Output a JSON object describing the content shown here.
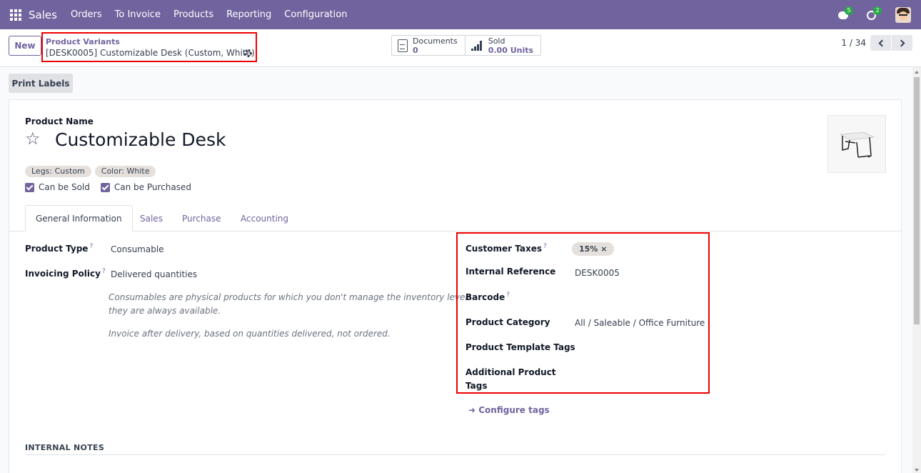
{
  "navbar": {
    "app_name": "Sales",
    "menu": [
      "Orders",
      "To Invoice",
      "Products",
      "Reporting",
      "Configuration"
    ],
    "messages_count": "5",
    "activities_count": "2"
  },
  "control": {
    "new_label": "New",
    "breadcrumb_parent": "Product Variants",
    "breadcrumb_current": "[DESK0005] Customizable Desk (Custom, White)",
    "stats": {
      "documents_label": "Documents",
      "documents_value": "0",
      "sold_label": "Sold",
      "sold_value": "0.00 Units"
    },
    "pager": "1 / 34"
  },
  "actions": {
    "print_labels": "Print Labels"
  },
  "form": {
    "product_name_label": "Product Name",
    "product_name": "Customizable Desk",
    "attribute_tags": [
      "Legs: Custom",
      "Color: White"
    ],
    "can_be_sold": "Can be Sold",
    "can_be_purchased": "Can be Purchased",
    "tabs": [
      "General Information",
      "Sales",
      "Purchase",
      "Accounting"
    ],
    "left": {
      "product_type_label": "Product Type",
      "product_type_value": "Consumable",
      "invoicing_policy_label": "Invoicing Policy",
      "invoicing_policy_value": "Delivered quantities",
      "help_consumable_1": "Consumables are physical products for which you don't manage the inventory level:",
      "help_consumable_2": "they are always available.",
      "help_invoice": "Invoice after delivery, based on quantities delivered, not ordered."
    },
    "right": {
      "customer_taxes_label": "Customer Taxes",
      "customer_taxes_value": "15%",
      "internal_reference_label": "Internal Reference",
      "internal_reference_value": "DESK0005",
      "barcode_label": "Barcode",
      "product_category_label": "Product Category",
      "product_category_value": "All / Saleable / Office Furniture",
      "template_tags_label": "Product Template Tags",
      "additional_tags_label_1": "Additional Product",
      "additional_tags_label_2": "Tags",
      "configure_tags": "Configure tags"
    },
    "internal_notes": "INTERNAL NOTES"
  },
  "colors": {
    "brand": "#71639e",
    "highlight": "#ee0000"
  },
  "icons": [
    "apps-icon",
    "chat-icon",
    "clock-icon",
    "gear-icon",
    "document-icon",
    "signal-icon",
    "star-icon",
    "chevron-left-icon",
    "chevron-right-icon",
    "arrow-right-icon"
  ]
}
